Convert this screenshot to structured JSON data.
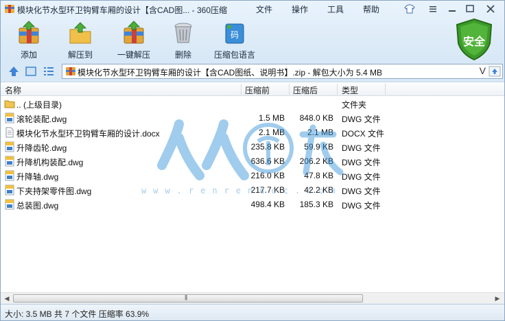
{
  "window": {
    "title": "模块化节水型环卫钩臂车厢的设计【含CAD图... - 360压缩"
  },
  "menu": {
    "items": [
      "文件",
      "操作",
      "工具",
      "帮助"
    ]
  },
  "toolbar": {
    "add": "添加",
    "extract_to": "解压到",
    "one_click_extract": "一键解压",
    "delete": "删除",
    "language": "压缩包语言",
    "security": "安全"
  },
  "address": {
    "path": "模块化节水型环卫钩臂车厢的设计【含CAD图纸、说明书】.zip - 解包大小为 5.4 MB",
    "dropdown_glyph": "V"
  },
  "columns": {
    "name": "名称",
    "compressed": "压缩前",
    "uncompressed": "压缩后",
    "type": "类型"
  },
  "files": [
    {
      "name": ".. (上级目录)",
      "compressed": "",
      "uncompressed": "",
      "type": "文件夹",
      "icon": "folder-icon"
    },
    {
      "name": "滚轮装配.dwg",
      "compressed": "1.5 MB",
      "uncompressed": "848.0 KB",
      "type": "DWG 文件",
      "icon": "dwg-file-icon"
    },
    {
      "name": "模块化节水型环卫钩臂车厢的设计.docx",
      "compressed": "2.1 MB",
      "uncompressed": "2.1 MB",
      "type": "DOCX 文件",
      "icon": "docx-file-icon"
    },
    {
      "name": "升降齿轮.dwg",
      "compressed": "235.8 KB",
      "uncompressed": "59.9 KB",
      "type": "DWG 文件",
      "icon": "dwg-file-icon"
    },
    {
      "name": "升降机构装配.dwg",
      "compressed": "636.6 KB",
      "uncompressed": "206.2 KB",
      "type": "DWG 文件",
      "icon": "dwg-file-icon"
    },
    {
      "name": "升降轴.dwg",
      "compressed": "216.0 KB",
      "uncompressed": "47.8 KB",
      "type": "DWG 文件",
      "icon": "dwg-file-icon"
    },
    {
      "name": "下夹持架零件图.dwg",
      "compressed": "217.7 KB",
      "uncompressed": "42.2 KB",
      "type": "DWG 文件",
      "icon": "dwg-file-icon"
    },
    {
      "name": "总装图.dwg",
      "compressed": "498.4 KB",
      "uncompressed": "185.3 KB",
      "type": "DWG 文件",
      "icon": "dwg-file-icon"
    }
  ],
  "watermark": {
    "text": "www.renrendoc.com"
  },
  "status": {
    "text": "大小: 3.5 MB 共 7 个文件 压缩率 63.9%"
  },
  "colors": {
    "accent_blue": "#2f77c9",
    "shield_green": "#3d9a2a",
    "window_bg": "#dcebf8"
  }
}
